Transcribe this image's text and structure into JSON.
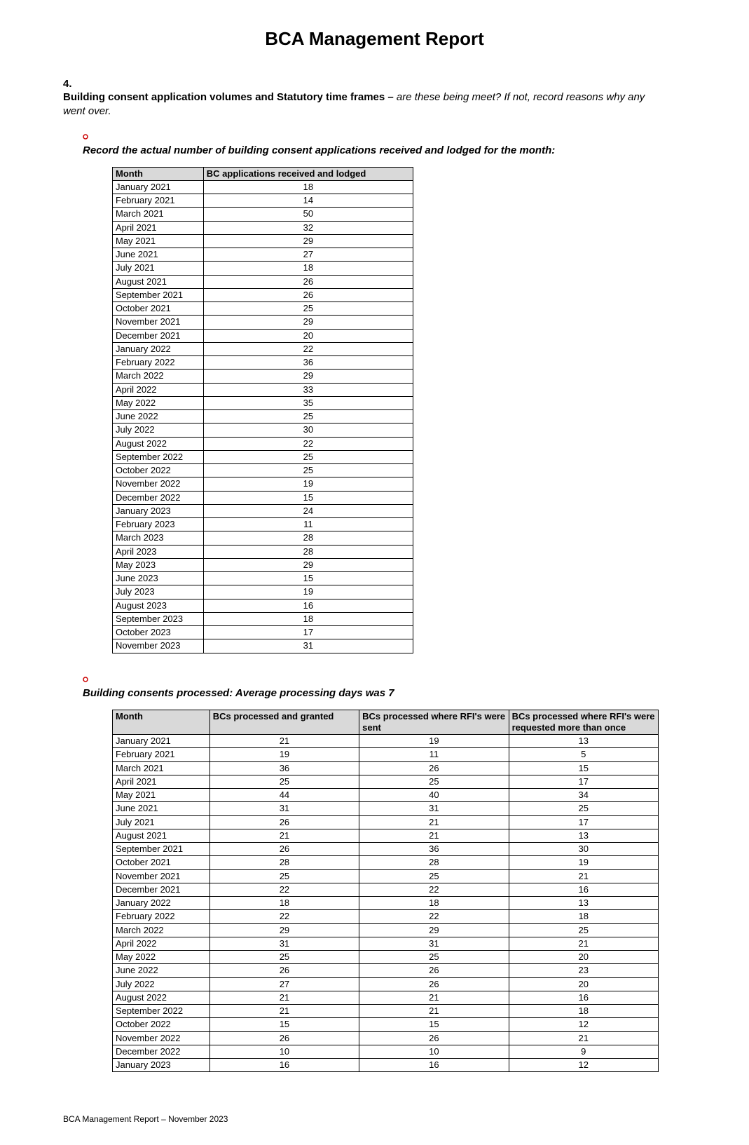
{
  "title": "BCA Management Report",
  "section": {
    "number": "4.",
    "heading_bold": "Building consent application volumes and Statutory time frames –",
    "heading_ital": " are these being meet? If not, record reasons why any went over."
  },
  "bullet1": "Record the actual number of building consent applications received and lodged for the month:",
  "table1": {
    "headers": [
      "Month",
      "BC applications received and lodged"
    ],
    "rows": [
      [
        "January 2021",
        "18"
      ],
      [
        "February 2021",
        "14"
      ],
      [
        "March 2021",
        "50"
      ],
      [
        "April 2021",
        "32"
      ],
      [
        "May 2021",
        "29"
      ],
      [
        "June 2021",
        "27"
      ],
      [
        "July 2021",
        "18"
      ],
      [
        "August 2021",
        "26"
      ],
      [
        "September 2021",
        "26"
      ],
      [
        "October 2021",
        "25"
      ],
      [
        "November 2021",
        "29"
      ],
      [
        "December 2021",
        "20"
      ],
      [
        "January 2022",
        "22"
      ],
      [
        "February 2022",
        "36"
      ],
      [
        "March 2022",
        "29"
      ],
      [
        "April 2022",
        "33"
      ],
      [
        "May 2022",
        "35"
      ],
      [
        "June 2022",
        "25"
      ],
      [
        "July 2022",
        "30"
      ],
      [
        "August 2022",
        "22"
      ],
      [
        "September 2022",
        "25"
      ],
      [
        "October 2022",
        "25"
      ],
      [
        "November 2022",
        "19"
      ],
      [
        "December 2022",
        "15"
      ],
      [
        "January 2023",
        "24"
      ],
      [
        "February 2023",
        "11"
      ],
      [
        "March 2023",
        "28"
      ],
      [
        "April 2023",
        "28"
      ],
      [
        "May 2023",
        "29"
      ],
      [
        "June 2023",
        "15"
      ],
      [
        "July 2023",
        "19"
      ],
      [
        "August 2023",
        "16"
      ],
      [
        "September 2023",
        "18"
      ],
      [
        "October 2023",
        "17"
      ],
      [
        "November 2023",
        "31"
      ]
    ]
  },
  "bullet2": "Building consents processed: Average processing days was 7",
  "table2": {
    "headers": [
      "Month",
      "BCs processed and granted",
      "BCs processed where RFI's were sent",
      "BCs processed where RFI's were requested more than once"
    ],
    "rows": [
      [
        "January 2021",
        "21",
        "19",
        "13"
      ],
      [
        "February 2021",
        "19",
        "11",
        "5"
      ],
      [
        "March 2021",
        "36",
        "26",
        "15"
      ],
      [
        "April 2021",
        "25",
        "25",
        "17"
      ],
      [
        "May 2021",
        "44",
        "40",
        "34"
      ],
      [
        "June 2021",
        "31",
        "31",
        "25"
      ],
      [
        "July 2021",
        "26",
        "21",
        "17"
      ],
      [
        "August 2021",
        "21",
        "21",
        "13"
      ],
      [
        "September 2021",
        "26",
        "36",
        "30"
      ],
      [
        "October 2021",
        "28",
        "28",
        "19"
      ],
      [
        "November 2021",
        "25",
        "25",
        "21"
      ],
      [
        "December 2021",
        "22",
        "22",
        "16"
      ],
      [
        "January 2022",
        "18",
        "18",
        "13"
      ],
      [
        "February 2022",
        "22",
        "22",
        "18"
      ],
      [
        "March 2022",
        "29",
        "29",
        "25"
      ],
      [
        "April 2022",
        "31",
        "31",
        "21"
      ],
      [
        "May 2022",
        "25",
        "25",
        "20"
      ],
      [
        "June 2022",
        "26",
        "26",
        "23"
      ],
      [
        "July 2022",
        "27",
        "26",
        "20"
      ],
      [
        "August 2022",
        "21",
        "21",
        "16"
      ],
      [
        "September 2022",
        "21",
        "21",
        "18"
      ],
      [
        "October 2022",
        "15",
        "15",
        "12"
      ],
      [
        "November 2022",
        "26",
        "26",
        "21"
      ],
      [
        "December 2022",
        "10",
        "10",
        "9"
      ],
      [
        "January 2023",
        "16",
        "16",
        "12"
      ]
    ]
  },
  "footer": "BCA Management Report – November 2023"
}
